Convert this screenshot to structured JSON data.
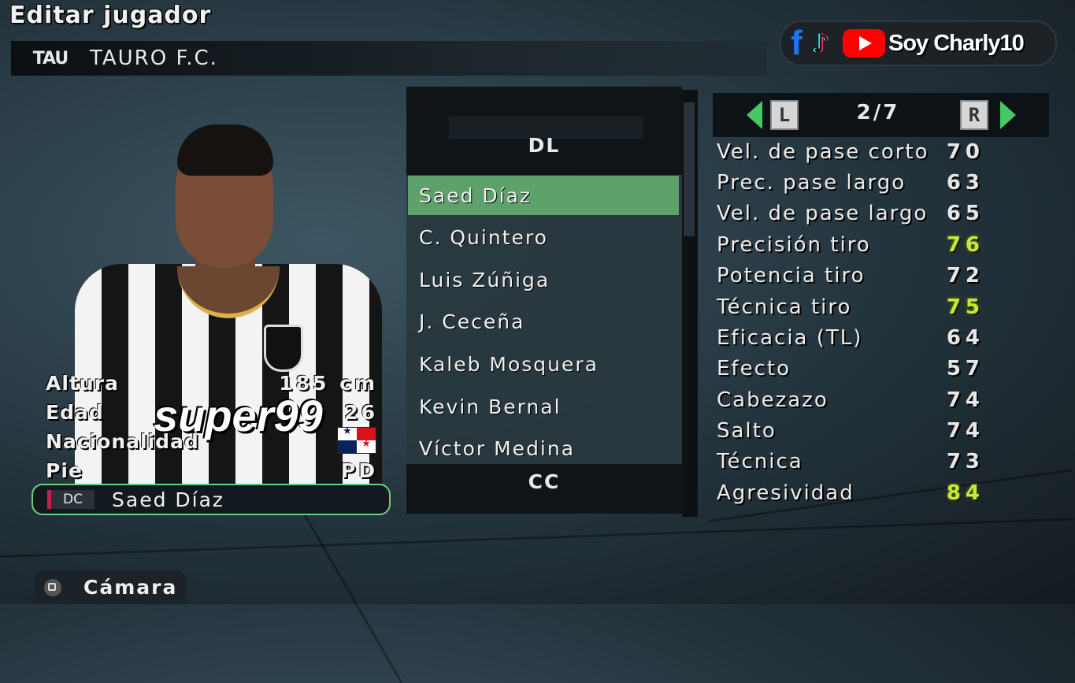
{
  "screen": {
    "title": "Editar jugador"
  },
  "team": {
    "abbr": "TAU",
    "name": "TAURO F.C."
  },
  "brand": {
    "text": "Soy Charly10",
    "icons": [
      "facebook-icon",
      "tiktok-icon",
      "youtube-icon"
    ]
  },
  "player": {
    "jersey_sponsor": "super99",
    "info": [
      {
        "label": "Altura",
        "value": "185 cm"
      },
      {
        "label": "Edad",
        "value": "26"
      },
      {
        "label": "Nacionalidad",
        "value": ""
      },
      {
        "label": "Pie",
        "value": "PD"
      }
    ],
    "nationality_flag": "panama-flag",
    "position": "DC",
    "name": "Saed Díaz",
    "position_color": "#c32147"
  },
  "list": {
    "group_top": "DL",
    "group_bottom": "CC",
    "players": [
      "Saed Díaz",
      "C. Quintero",
      "Luis Zúñiga",
      "J. Ceceña",
      "Kaleb Mosquera",
      "Kevin Bernal",
      "Víctor Medina"
    ],
    "selected_index": 0,
    "selected_color": "#5ea26b"
  },
  "stats": {
    "page": "2/7",
    "left_button": "L",
    "right_button": "R",
    "rows": [
      {
        "label": "Vel. de pase corto",
        "value": "70",
        "highlight": false
      },
      {
        "label": "Prec. pase largo",
        "value": "63",
        "highlight": false
      },
      {
        "label": "Vel. de pase largo",
        "value": "65",
        "highlight": false
      },
      {
        "label": "Precisión tiro",
        "value": "76",
        "highlight": true
      },
      {
        "label": "Potencia tiro",
        "value": "72",
        "highlight": false
      },
      {
        "label": "Técnica tiro",
        "value": "75",
        "highlight": true
      },
      {
        "label": "Eficacia (TL)",
        "value": "64",
        "highlight": false
      },
      {
        "label": "Efecto",
        "value": "57",
        "highlight": false
      },
      {
        "label": "Cabezazo",
        "value": "74",
        "highlight": false
      },
      {
        "label": "Salto",
        "value": "74",
        "highlight": false
      },
      {
        "label": "Técnica",
        "value": "73",
        "highlight": false
      },
      {
        "label": "Agresividad",
        "value": "84",
        "highlight": true
      }
    ],
    "highlight_color": "#c8e63c"
  },
  "footer": {
    "camera_label": "Cámara"
  }
}
